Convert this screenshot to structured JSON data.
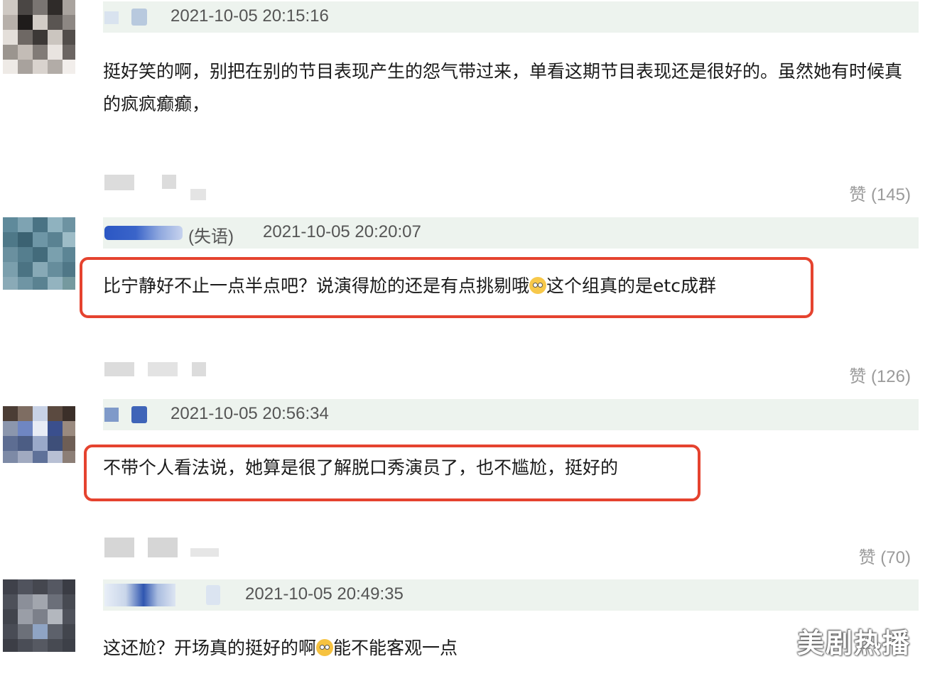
{
  "comments": [
    {
      "time": "2021-10-05 20:15:16",
      "text": "挺好笑的啊，别把在别的节目表现产生的怨气带过来，单看这期节目表现还是很好的。虽然她有时候真的疯疯癫癫，",
      "likes": "赞 (145)"
    },
    {
      "username_suffix": "(失语)",
      "time": "2021-10-05 20:20:07",
      "text_part1": "比宁静好不止一点半点吧？说演得尬的还是有点挑剔哦",
      "emoji_icon": "rolling-eyes-emoji-icon",
      "text_part2": "这个组真的是etc成群",
      "likes": "赞 (126)"
    },
    {
      "time": "2021-10-05 20:56:34",
      "text": "不带个人看法说，她算是很了解脱口秀演员了，也不尴尬，挺好的",
      "likes": "赞 (70)"
    },
    {
      "time": "2021-10-05 20:49:35",
      "text_part1": "这还尬？开场真的挺好的啊",
      "emoji_icon": "sweat-smile-emoji-icon",
      "text_part2": "能不能客观一点"
    }
  ],
  "watermark": "美剧热播",
  "colors": {
    "meta_bar_bg": "#edf3ee",
    "highlight_border": "#e5432f",
    "like_text": "#9a9a9a"
  }
}
